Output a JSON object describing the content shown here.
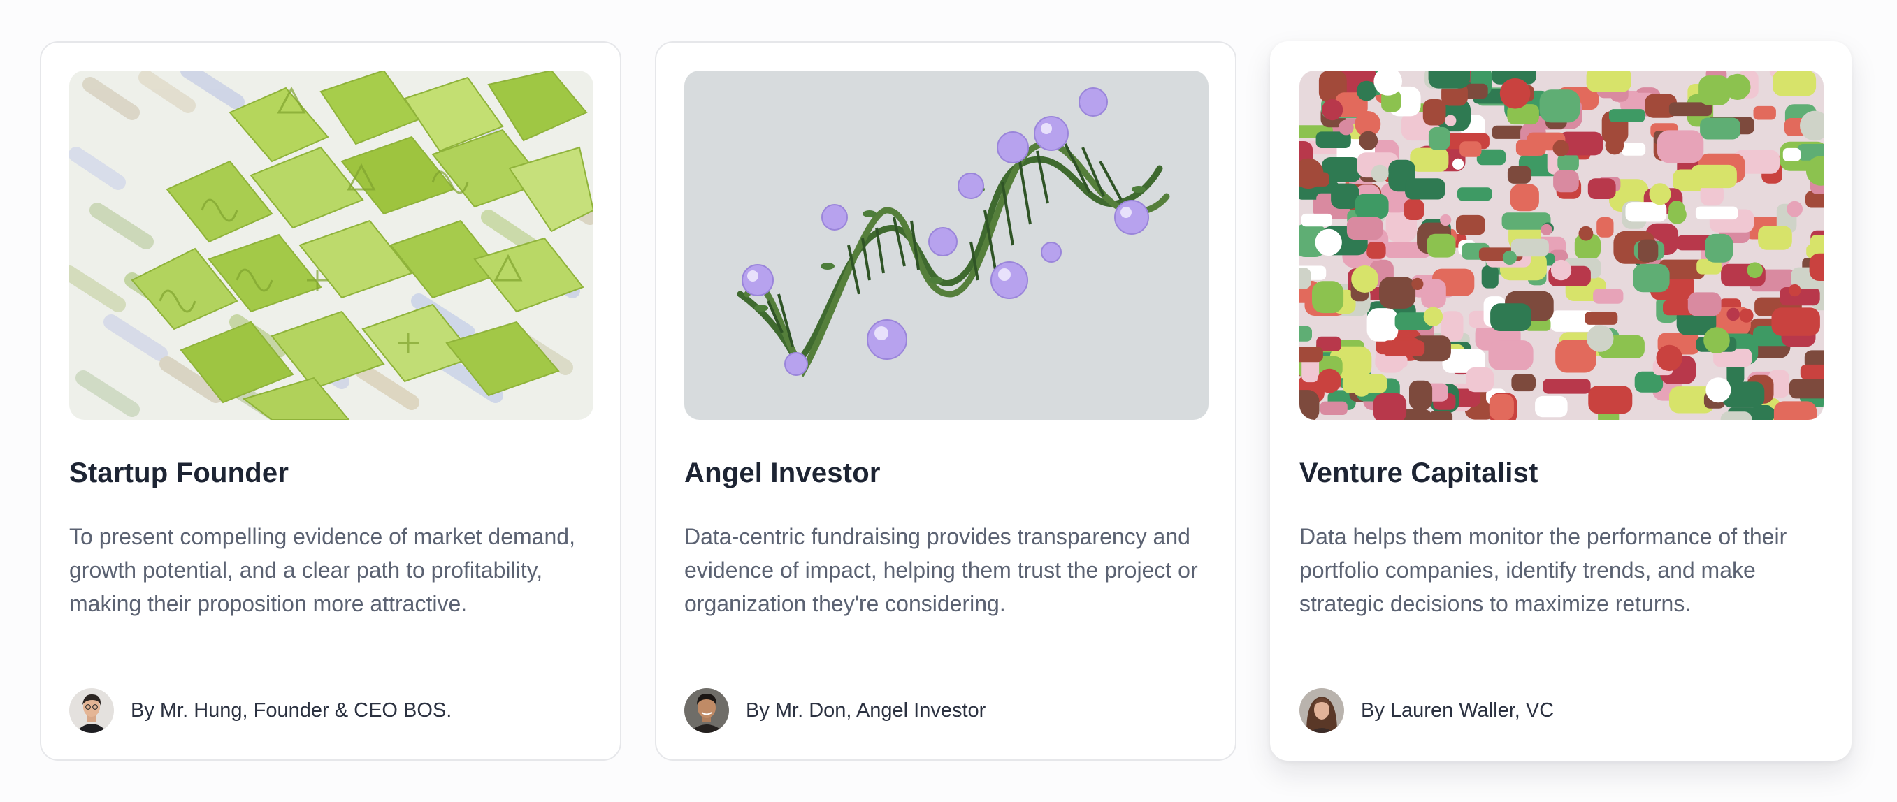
{
  "cards": [
    {
      "image": "green-math-tiles-illustration",
      "title": "Startup Founder",
      "description": "To present compelling evidence of market demand, growth potential, and a clear path to profitability, making their proposition more attractive.",
      "author": "By Mr. Hung, Founder & CEO BOS.",
      "avatar": "man-avatar"
    },
    {
      "image": "floral-dna-helix-illustration",
      "title": "Angel Investor",
      "description": "Data-centric fundraising provides transparency and evidence of impact, helping them trust the project or organization they're considering.",
      "author": "By Mr. Don, Angel Investor",
      "avatar": "man-avatar"
    },
    {
      "image": "colorful-blocks-illustration",
      "title": "Venture Capitalist",
      "description": "Data helps them monitor the performance of their portfolio companies, identify trends, and make strategic decisions to maximize returns.",
      "author": "By Lauren Waller, VC",
      "avatar": "woman-avatar"
    }
  ],
  "colors": {
    "title": "#1d2433",
    "body": "#5b6272",
    "card_border": "#e6e7ea",
    "math_green": "#a6cc4a",
    "dna_background": "#d7dbdd",
    "flower_purple": "#b7a2ee"
  }
}
